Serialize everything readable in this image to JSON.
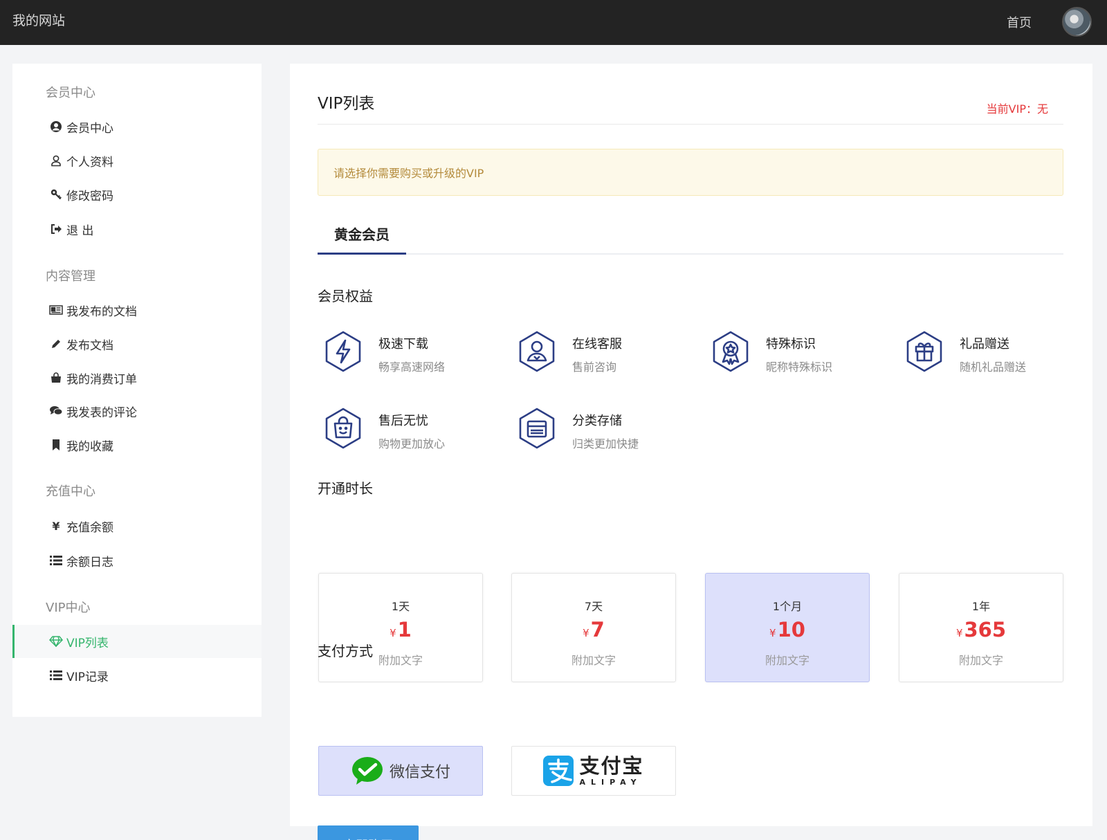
{
  "header": {
    "site_title": "我的网站",
    "nav_home": "首页"
  },
  "sidebar": {
    "groups": [
      {
        "label": "会员中心",
        "items": [
          {
            "label": "会员中心",
            "icon": "user-circle-icon"
          },
          {
            "label": "个人资料",
            "icon": "user-icon"
          },
          {
            "label": "修改密码",
            "icon": "key-icon"
          },
          {
            "label": "退 出",
            "icon": "sign-out-icon"
          }
        ]
      },
      {
        "label": "内容管理",
        "items": [
          {
            "label": "我发布的文档",
            "icon": "newspaper-icon"
          },
          {
            "label": "发布文档",
            "icon": "pencil-icon"
          },
          {
            "label": "我的消费订单",
            "icon": "shopping-bag-icon"
          },
          {
            "label": "我发表的评论",
            "icon": "comments-icon"
          },
          {
            "label": "我的收藏",
            "icon": "bookmark-icon"
          }
        ]
      },
      {
        "label": "充值中心",
        "items": [
          {
            "label": "充值余额",
            "icon": "yen-icon"
          },
          {
            "label": "余额日志",
            "icon": "list-icon"
          }
        ]
      },
      {
        "label": "VIP中心",
        "items": [
          {
            "label": "VIP列表",
            "icon": "diamond-icon",
            "active": true
          },
          {
            "label": "VIP记录",
            "icon": "list-icon"
          }
        ]
      }
    ]
  },
  "main": {
    "title": "VIP列表",
    "current_vip": "当前VIP：无",
    "notice": "请选择你需要购买或升级的VIP",
    "tabs": [
      {
        "label": "黄金会员",
        "active": true
      }
    ],
    "benefits_title": "会员权益",
    "benefits": [
      {
        "name": "极速下载",
        "desc": "畅享高速网络",
        "icon": "lightning-icon"
      },
      {
        "name": "在线客服",
        "desc": "售前咨询",
        "icon": "customer-service-icon"
      },
      {
        "name": "特殊标识",
        "desc": "昵称特殊标识",
        "icon": "badge-star-icon"
      },
      {
        "name": "礼品赠送",
        "desc": "随机礼品赠送",
        "icon": "gift-icon"
      },
      {
        "name": "售后无忧",
        "desc": "购物更加放心",
        "icon": "shopping-bag-smile-icon"
      },
      {
        "name": "分类存储",
        "desc": "归类更加快捷",
        "icon": "storage-card-icon"
      }
    ],
    "duration_title": "开通时长",
    "plans": [
      {
        "name": "1天",
        "currency": "¥",
        "price": "1",
        "note": "附加文字",
        "selected": false
      },
      {
        "name": "7天",
        "currency": "¥",
        "price": "7",
        "note": "附加文字",
        "selected": false
      },
      {
        "name": "1个月",
        "currency": "¥",
        "price": "10",
        "note": "附加文字",
        "selected": true
      },
      {
        "name": "1年",
        "currency": "¥",
        "price": "365",
        "note": "附加文字",
        "selected": false
      }
    ],
    "payment_title": "支付方式",
    "payments": {
      "wechat_label": "微信支付",
      "alipay_cn": "支付宝",
      "alipay_en": "ALIPAY"
    },
    "buy_button": "立即购买",
    "colors": {
      "accent_green": "#35b56d",
      "price_red": "#e5393b",
      "tab_underline": "#2c3e85",
      "buy_button": "#3b97e0",
      "selected_bg": "#dde0fb",
      "icon_navy": "#2c3e85"
    }
  }
}
